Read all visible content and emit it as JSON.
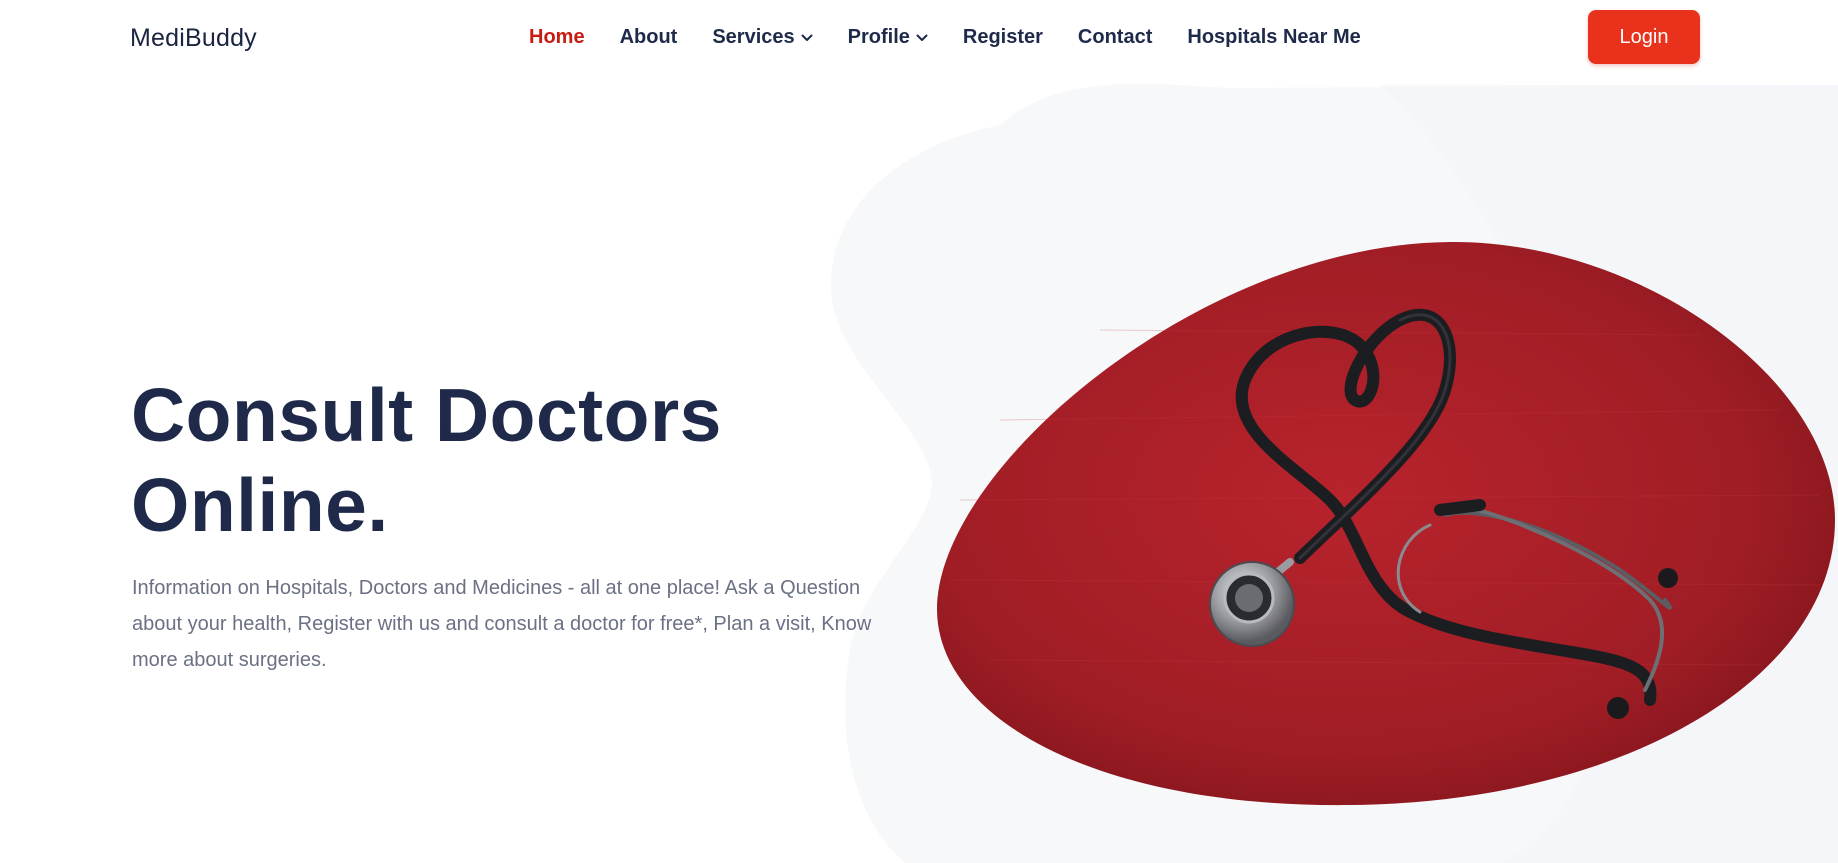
{
  "brand": {
    "name": "MediBuddy"
  },
  "nav": {
    "items": [
      {
        "label": "Home",
        "active": true,
        "dropdown": false
      },
      {
        "label": "About",
        "active": false,
        "dropdown": false
      },
      {
        "label": "Services",
        "active": false,
        "dropdown": true
      },
      {
        "label": "Profile",
        "active": false,
        "dropdown": true
      },
      {
        "label": "Register",
        "active": false,
        "dropdown": false
      },
      {
        "label": "Contact",
        "active": false,
        "dropdown": false
      },
      {
        "label": "Hospitals Near Me",
        "active": false,
        "dropdown": false
      }
    ],
    "login_label": "Login"
  },
  "hero": {
    "title_line1": "Consult Doctors",
    "title_line2": "Online.",
    "description": "Information on Hospitals, Doctors and Medicines - all at one place! Ask a Question about your health, Register with us and consult a doctor for free*, Plan a visit, Know more about surgeries.",
    "image_subject": "stethoscope-heart-image"
  },
  "colors": {
    "accent": "#e8321c",
    "active_nav": "#c81c12",
    "heading": "#1f2a4a",
    "body_text": "#6b7184",
    "image_red": "#a61d25"
  }
}
